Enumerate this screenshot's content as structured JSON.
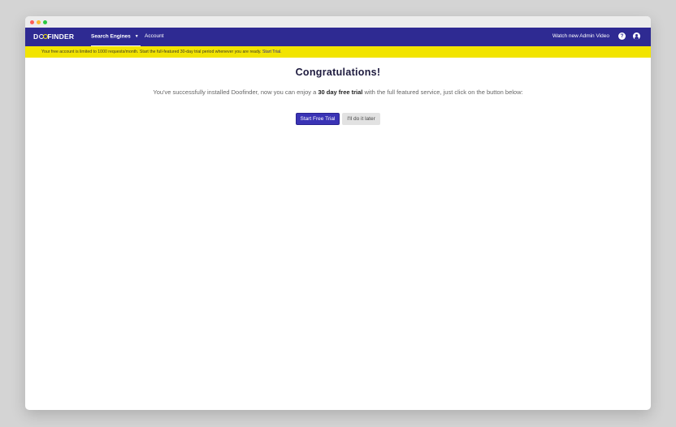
{
  "navbar": {
    "logo_pre": "D",
    "logo_post": "FINDER",
    "search_engines": "Search Engines",
    "account": "Account",
    "watch_video": "Watch new Admin Video",
    "help_glyph": "?"
  },
  "banner": {
    "text": "Your free account is limited to 1000 requests/month. Start the full-featured 30-day trial period whenever you are ready.",
    "link": "Start Trial."
  },
  "main": {
    "title": "Congratulations!",
    "lead_before": "You've successfully installed Doofinder, now you can enjoy a ",
    "lead_bold": "30 day free trial",
    "lead_after": " with the full featured service, just click on the button below:",
    "primary_button": "Start Free Trial",
    "secondary_button": "I'll do it later"
  },
  "colors": {
    "brand": "#2e2a92",
    "banner": "#f2e400",
    "primary_button": "#3a33b5"
  },
  "icons": [
    "help-icon",
    "user-account-icon",
    "chevron-down-icon"
  ]
}
